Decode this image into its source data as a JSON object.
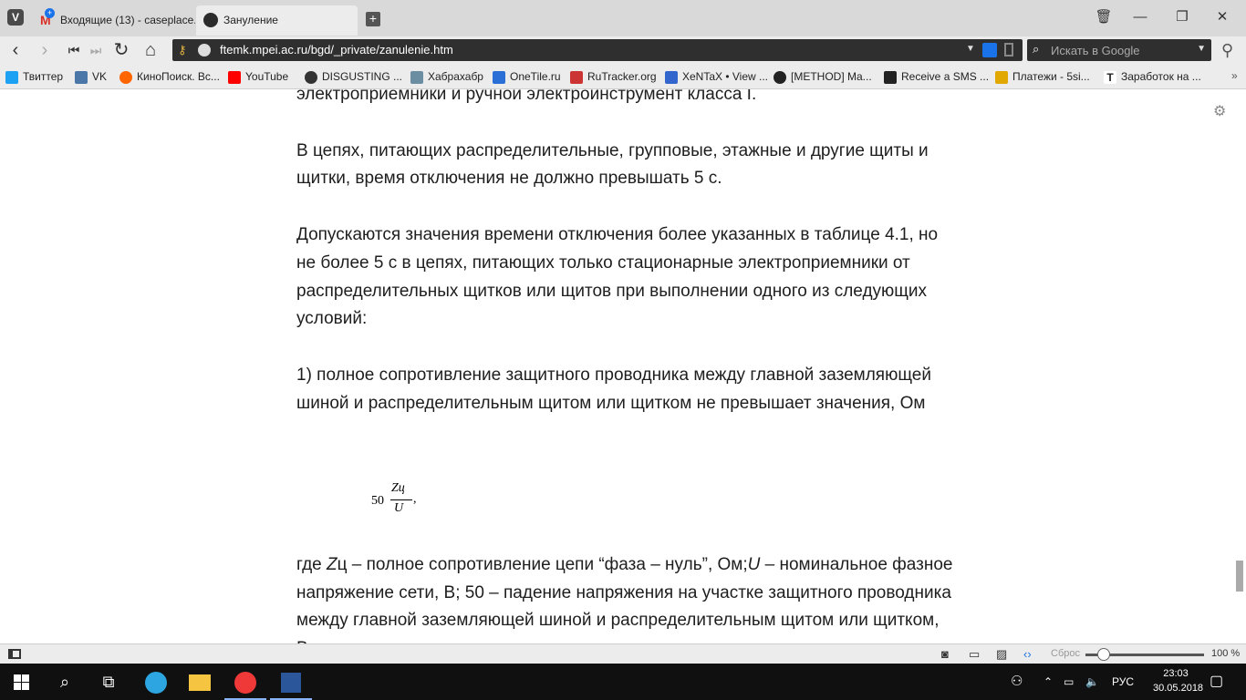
{
  "tabs": [
    {
      "label": "Входящие (13) - caseplace.a",
      "badge": "+",
      "active": false
    },
    {
      "label": "Зануление",
      "active": true
    }
  ],
  "window_controls": {
    "trash": "🗑",
    "minimize": "—",
    "restore": "❐",
    "close": "✕"
  },
  "nav": {
    "back": "‹",
    "forward": "›",
    "first": "⏮",
    "last": "⏭",
    "reload": "↻",
    "home": "⌂"
  },
  "address": {
    "url": "ftemk.mpei.ac.ru/bgd/_private/zanulenie.htm"
  },
  "search": {
    "placeholder": "Искать в Google"
  },
  "bookmarks": [
    {
      "label": "Твиттер",
      "icon": "twitter-icon",
      "color": "#1da1f2"
    },
    {
      "label": "VK",
      "icon": "vk-icon",
      "color": "#4a76a8"
    },
    {
      "label": "КиноПоиск. Вс...",
      "icon": "kinopoisk-icon",
      "color": "#f60"
    },
    {
      "label": "YouTube",
      "icon": "youtube-icon",
      "color": "#f00"
    },
    {
      "label": "DISGUSTING ...",
      "icon": "disgusting-icon",
      "color": "#333"
    },
    {
      "label": "Хабрахабр",
      "icon": "habr-icon",
      "color": "#6c8ea3"
    },
    {
      "label": "OneTile.ru",
      "icon": "onetile-icon",
      "color": "#2a6fd6"
    },
    {
      "label": "RuTracker.org",
      "icon": "rutracker-icon",
      "color": "#c33"
    },
    {
      "label": "XeNTaX • View ...",
      "icon": "xentax-icon",
      "color": "#36c"
    },
    {
      "label": "[METHOD] Ma...",
      "icon": "method-icon",
      "color": "#222"
    },
    {
      "label": "Receive a SMS ...",
      "icon": "mail-icon",
      "color": "#222"
    },
    {
      "label": "Платежи - 5si...",
      "icon": "payments-icon",
      "color": "#e0a800"
    },
    {
      "label": "Заработок на ...",
      "icon": "t-icon",
      "color": "#222"
    }
  ],
  "article": {
    "p1": "электроприемники и ручной электроинструмент класса I.",
    "p2": "В цепях, питающих распределительные, групповые, этажные и другие щиты и щитки, время отключения не должно превышать 5 с.",
    "p3": "Допускаются значения времени отключения более указанных в таблице 4.1, но не более 5 с в цепях, питающих только стационарные электроприемники от распределительных щитков или щитов при выполнении одного из следующих условий:",
    "p4": "1) полное сопротивление защитного проводника между главной заземляющей шиной и распределительным щитом или щитком не превышает значения, Ом",
    "formula": {
      "coef": "50",
      "numerator": "Zц",
      "denominator": "U",
      "comma": ","
    },
    "p5_a": "где ",
    "p5_z": "Z",
    "p5_b": "ц – полное сопротивление цепи “фаза – нуль”, Ом;",
    "p5_u": "U",
    "p5_c": " – номинальное фазное напряжение сети, В; 50 – падение напряжения на участке защитного проводника между главной заземляющей шиной и распределительным щитом или щитком, В;"
  },
  "statusbar": {
    "reset": "Сброс",
    "zoom": "100 %",
    "zoom_level": 0.15
  },
  "taskbar": {
    "lang": "РУС",
    "time": "23:03",
    "date": "30.05.2018"
  }
}
